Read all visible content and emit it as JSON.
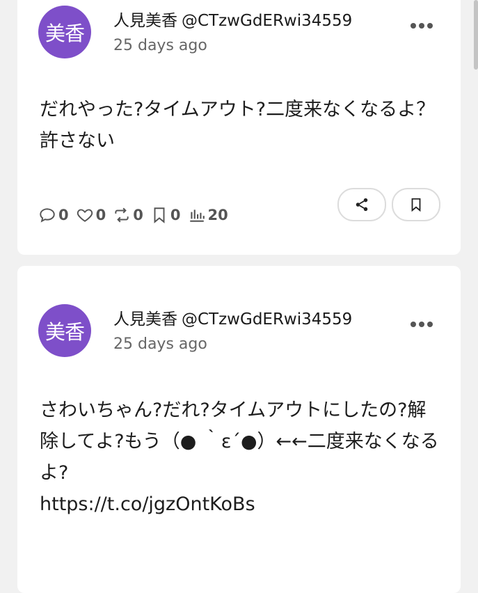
{
  "posts": [
    {
      "avatar_text": "美香",
      "display_name": "人見美香",
      "handle": "@CTzwGdERwi34559",
      "time": "25 days ago",
      "text": "だれやった?タイムアウト?二度来なくなるよ？許さない",
      "stats": {
        "replies": "0",
        "likes": "0",
        "reposts": "0",
        "bookmarks": "0",
        "views": "20"
      }
    },
    {
      "avatar_text": "美香",
      "display_name": "人見美香",
      "handle": "@CTzwGdERwi34559",
      "time": "25 days ago",
      "text": "さわいちゃん?だれ?タイムアウトにしたの?解除してよ?もう（● ｀ε´●）←←二度来なくなるよ?\nhttps://t.co/jgzOntKoBs"
    }
  ],
  "icons": {
    "reply": "comment-icon",
    "like": "heart-icon",
    "repost": "repost-icon",
    "bookmark": "bookmark-icon",
    "views": "views-chart-icon",
    "share": "share-icon",
    "more": "more-dots-icon"
  },
  "colors": {
    "avatar": "#7e4fc9",
    "background": "#f1f1f1"
  }
}
